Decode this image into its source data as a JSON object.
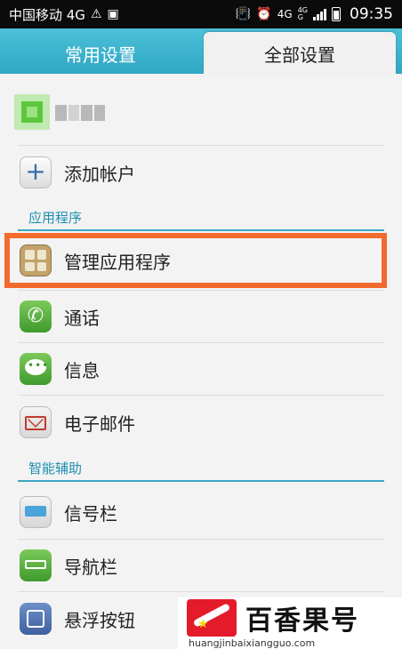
{
  "status_bar": {
    "carrier": "中国移动 4G",
    "net_main": "4G",
    "net_sub_top": "4G",
    "net_sub_bottom": "G",
    "time": "09:35"
  },
  "tabs": {
    "common": "常用设置",
    "all": "全部设置",
    "active": "全部设置"
  },
  "account": {
    "add_label": "添加帐户"
  },
  "sections": {
    "apps": "应用程序",
    "smart": "智能辅助"
  },
  "items": {
    "manage_apps": "管理应用程序",
    "call": "通话",
    "messages": "信息",
    "email": "电子邮件",
    "signal_bar": "信号栏",
    "nav_bar": "导航栏",
    "float_button": "悬浮按钮"
  },
  "watermark": {
    "brand": "百香果号",
    "url": "huangjinbaixiangguo.com"
  },
  "colors": {
    "tab_bar": "#3ab3cf",
    "section_text": "#1e8fb0",
    "highlight": "#f26a2e"
  }
}
